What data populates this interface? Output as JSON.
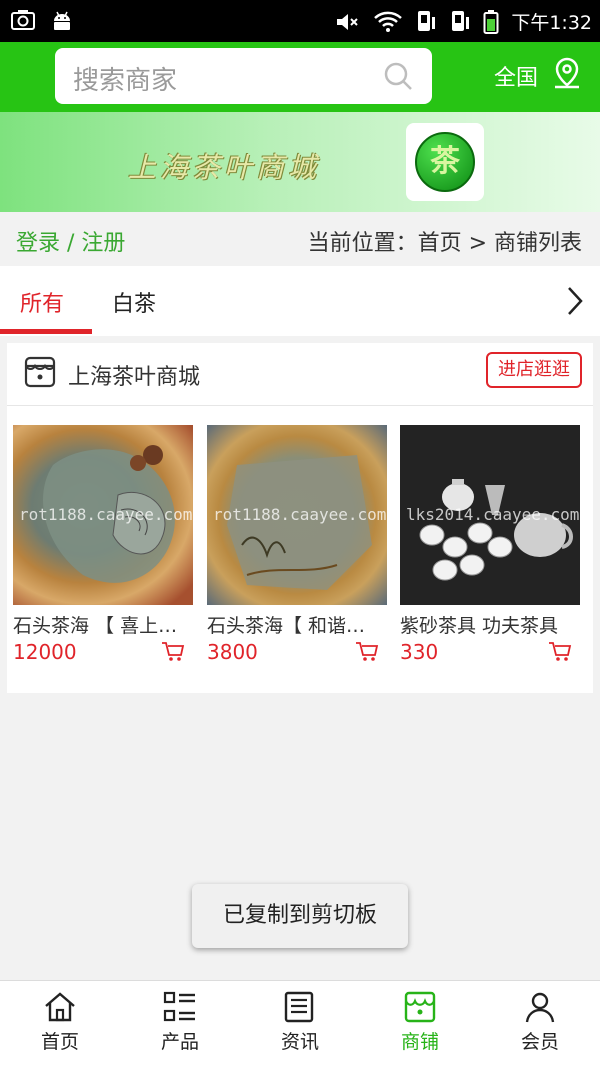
{
  "status_bar": {
    "time": "下午1:32"
  },
  "header": {
    "search_placeholder": "搜索商家",
    "region_label": "全国"
  },
  "banner": {
    "title": "上海茶叶商城",
    "logo_char": "茶"
  },
  "crumb": {
    "login_label": "登录 / 注册",
    "location": "当前位置：首页 > 商铺列表"
  },
  "tabs": [
    {
      "label": "所有",
      "active": true
    },
    {
      "label": "白茶",
      "active": false
    }
  ],
  "store": {
    "name": "上海茶叶商城",
    "enter_label": "进店逛逛",
    "products": [
      {
        "name": "石头茶海 【 喜上…",
        "price": "12000",
        "watermark": "rot1188.caayee.com"
      },
      {
        "name": "石头茶海【 和谐…",
        "price": "3800",
        "watermark": "rot1188.caayee.com"
      },
      {
        "name": "紫砂茶具 功夫茶具",
        "price": "330",
        "watermark": "lks2014.caayee.com"
      }
    ]
  },
  "toast": {
    "text": "已复制到剪切板"
  },
  "bottom_nav": [
    {
      "label": "首页",
      "icon": "home-icon",
      "active": false
    },
    {
      "label": "产品",
      "icon": "product-list-icon",
      "active": false
    },
    {
      "label": "资讯",
      "icon": "news-icon",
      "active": false
    },
    {
      "label": "商铺",
      "icon": "store-icon",
      "active": true
    },
    {
      "label": "会员",
      "icon": "user-icon",
      "active": false
    }
  ],
  "colors": {
    "brand_green": "#27c414",
    "accent_red": "#e0242a",
    "nav_active": "#27b318"
  }
}
